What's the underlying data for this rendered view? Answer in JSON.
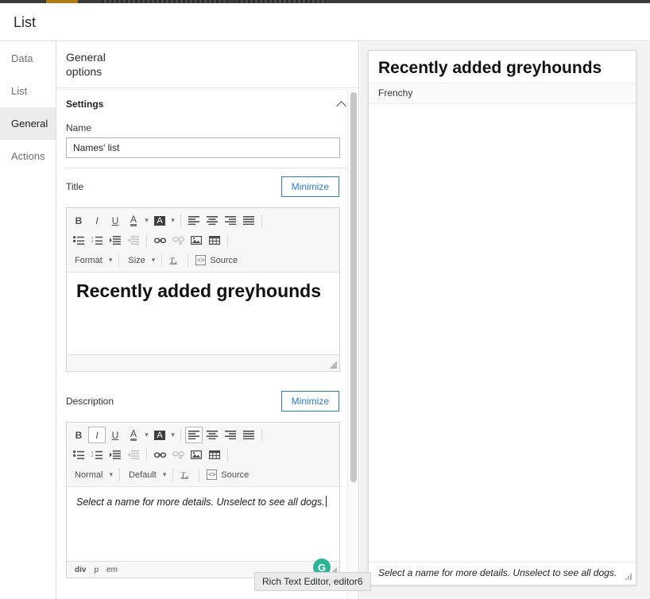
{
  "page": {
    "title": "List"
  },
  "tabs": [
    {
      "label": "Data",
      "active": false
    },
    {
      "label": "List",
      "active": false
    },
    {
      "label": "General",
      "active": true
    },
    {
      "label": "Actions",
      "active": false
    }
  ],
  "panel": {
    "header_line1": "General",
    "header_line2": "options",
    "settings_label": "Settings",
    "collapse_icon": "chevron-up-icon",
    "name_label": "Name",
    "name_value": "Names' list"
  },
  "title_section": {
    "label": "Title",
    "minimize_label": "Minimize",
    "content": "Recently added greyhounds"
  },
  "description_section": {
    "label": "Description",
    "minimize_label": "Minimize",
    "content": "Select a name for more details. Unselect to see all dogs.",
    "element_path": [
      "div",
      "p",
      "em"
    ]
  },
  "toolbar": {
    "bold": "B",
    "italic": "I",
    "underline": "U",
    "text_color": "A",
    "bg_color": "A",
    "caret": "▾",
    "align_left": "align-left-icon",
    "align_center": "align-center-icon",
    "align_right": "align-right-icon",
    "align_justify": "align-justify-icon",
    "bulleted_list": "bulleted-list-icon",
    "numbered_list": "numbered-list-icon",
    "indent": "indent-icon",
    "outdent": "outdent-icon",
    "link": "link-icon",
    "unlink": "unlink-icon",
    "image": "image-icon",
    "table": "table-icon",
    "remove_format": "remove-format-icon",
    "source_label": "Source",
    "format_title": "Format",
    "size_title": "Size",
    "format_desc": "Normal",
    "size_desc": "Default"
  },
  "tooltip": {
    "text": "Rich Text Editor, editor6"
  },
  "grammarly": {
    "letter": "G",
    "color": "#2bb596"
  },
  "preview": {
    "title": "Recently added greyhounds",
    "items": [
      "Frenchy"
    ],
    "footer": "Select a name for more details. Unselect to see all dogs."
  },
  "colors": {
    "accent_blue": "#2e7cc4",
    "tab_active_bg": "#ebebeb",
    "panel_bg": "#f2f2f2"
  }
}
